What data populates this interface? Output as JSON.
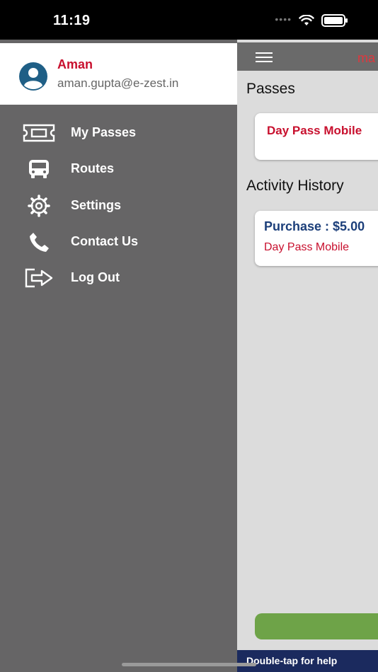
{
  "status_bar": {
    "time": "11:19"
  },
  "app_bar": {
    "title": "ma"
  },
  "main": {
    "passes_title": "Passes",
    "pass_card": {
      "name": "Day Pass Mobile"
    },
    "activity_title": "Activity History",
    "activity_card": {
      "amount": "Purchase : $5.00",
      "item": "Day Pass Mobile"
    },
    "help_text": "Double-tap for help"
  },
  "drawer": {
    "user": {
      "name": "Aman",
      "email": "aman.gupta@e-zest.in"
    },
    "items": [
      {
        "label": "My Passes",
        "icon": "ticket-icon"
      },
      {
        "label": "Routes",
        "icon": "bus-icon"
      },
      {
        "label": "Settings",
        "icon": "gear-icon"
      },
      {
        "label": "Contact Us",
        "icon": "phone-icon"
      },
      {
        "label": "Log Out",
        "icon": "logout-icon"
      }
    ]
  },
  "colors": {
    "accent_red": "#c8102e",
    "navy": "#1c3f7a",
    "drawer_bg": "#666566",
    "green": "#6ea348",
    "help_bar": "#1b2a5e"
  }
}
